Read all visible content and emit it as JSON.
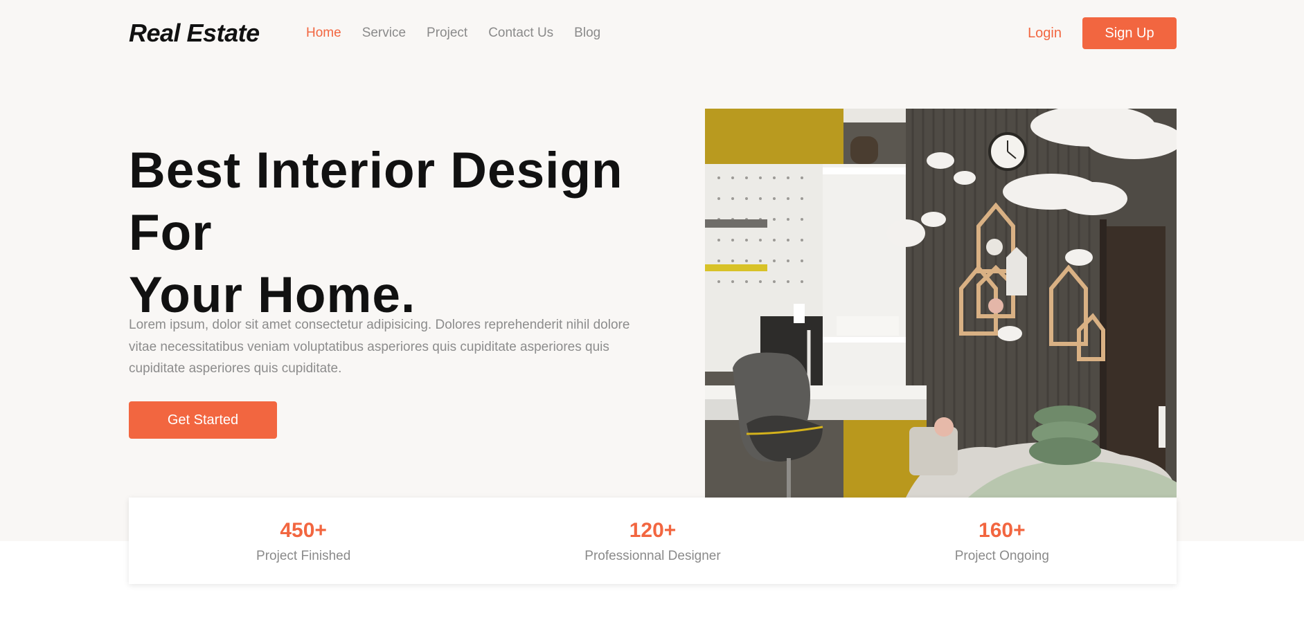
{
  "header": {
    "logo": "Real Estate",
    "nav": [
      {
        "label": "Home",
        "active": true
      },
      {
        "label": "Service",
        "active": false
      },
      {
        "label": "Project",
        "active": false
      },
      {
        "label": "Contact Us",
        "active": false
      },
      {
        "label": "Blog",
        "active": false
      }
    ],
    "login_label": "Login",
    "signup_label": "Sign Up"
  },
  "hero": {
    "title_line1": "Best Interior Design For",
    "title_line2": "Your Home.",
    "description": "Lorem ipsum, dolor sit amet consectetur adipisicing. Dolores reprehenderit nihil dolore vitae necessitatibus veniam voluptatibus asperiores quis cupiditate asperiores quis cupiditate asperiores quis cupiditate.",
    "cta_label": "Get Started",
    "image_icon": "kids-bedroom-interior-photo"
  },
  "stats": [
    {
      "value": "450+",
      "label": "Project Finished"
    },
    {
      "value": "120+",
      "label": "Professionnal Designer"
    },
    {
      "value": "160+",
      "label": "Project Ongoing"
    }
  ],
  "colors": {
    "accent": "#f26640",
    "hero_background": "#f9f7f5",
    "text_dark": "#111111",
    "text_muted": "#8a8a8a"
  }
}
